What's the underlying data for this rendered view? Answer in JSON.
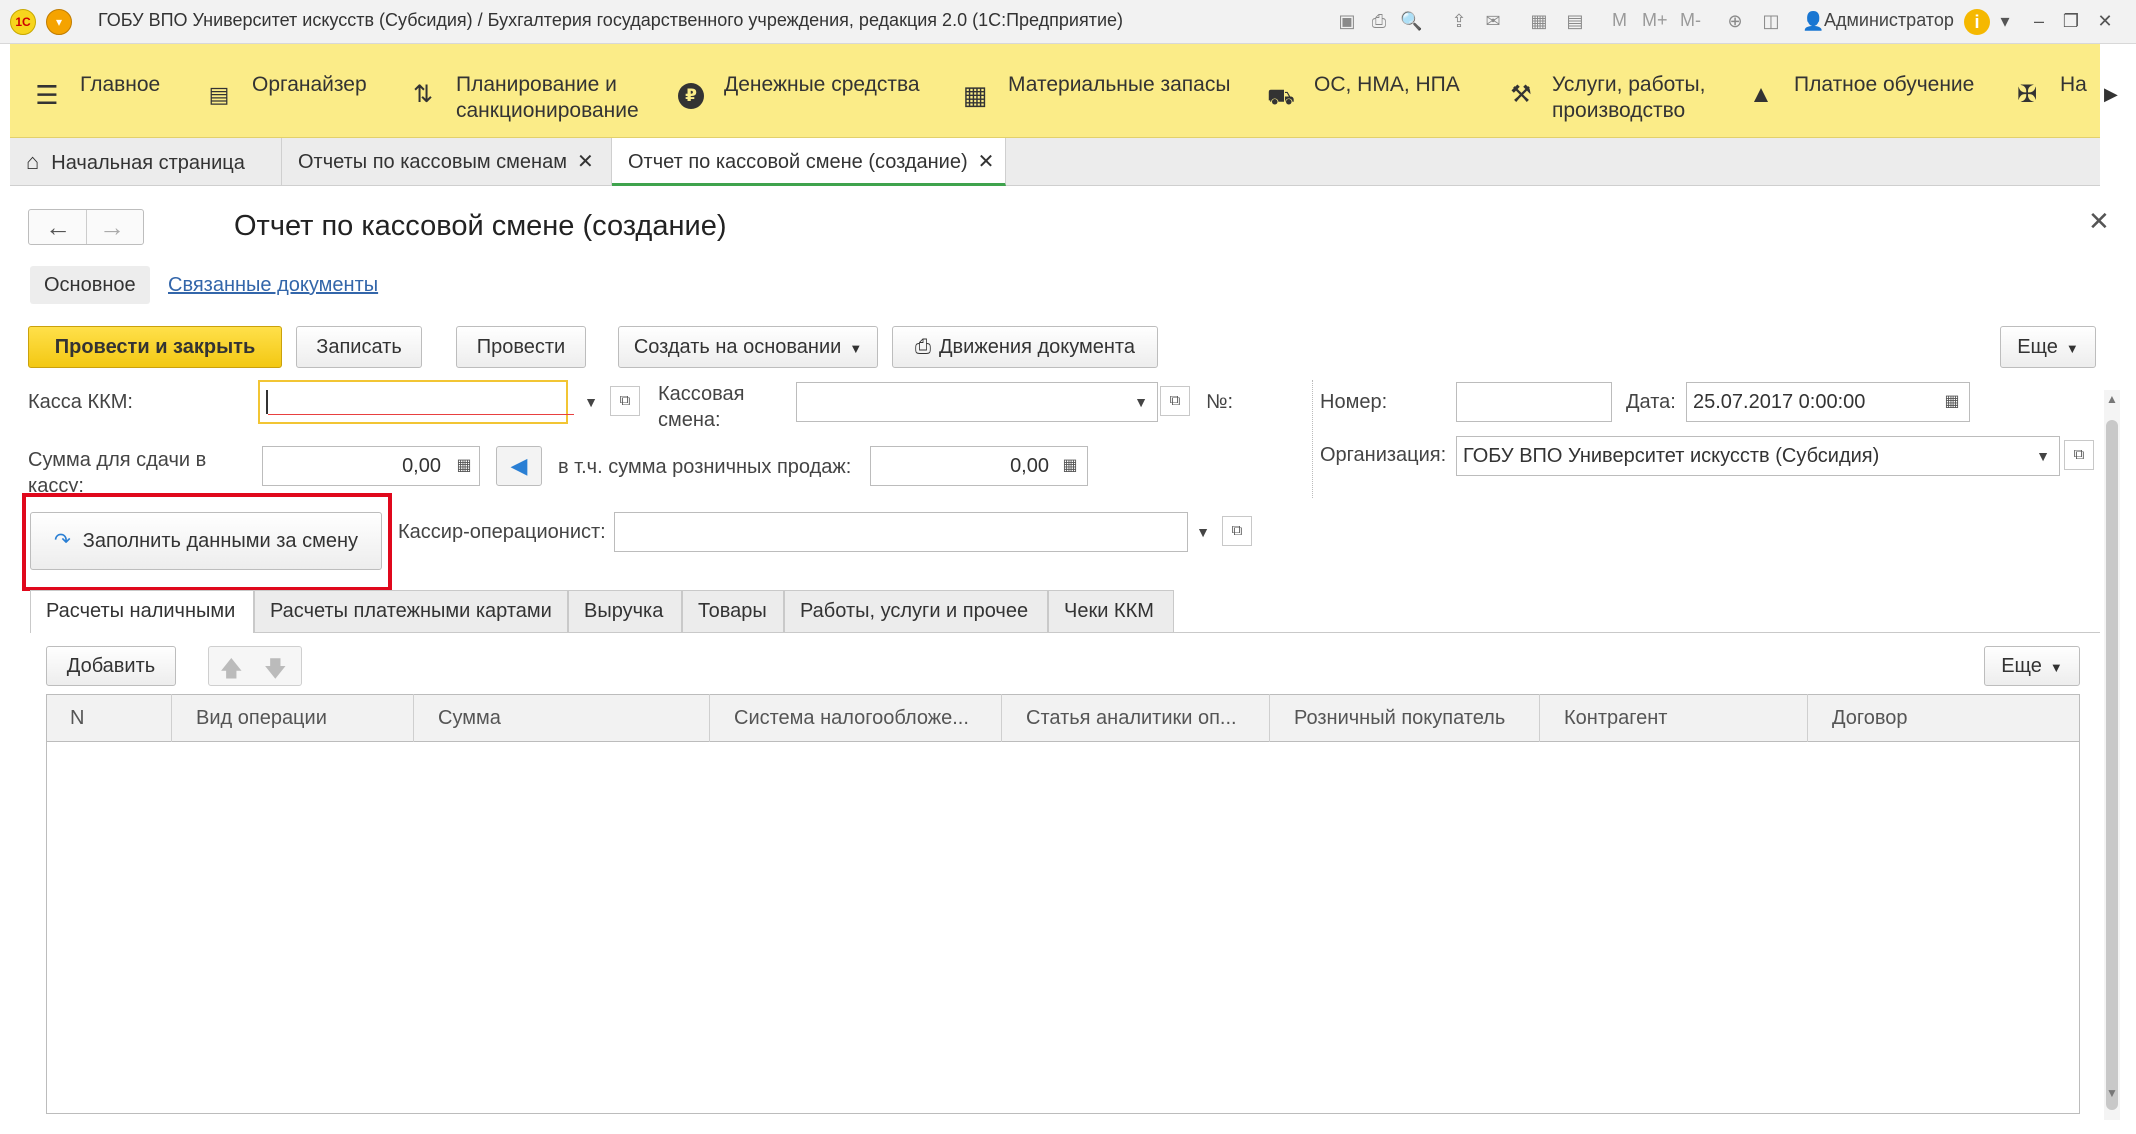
{
  "window": {
    "title": "ГОБУ ВПО Университет искусств (Субсидия) / Бухгалтерия государственного учреждения, редакция 2.0  (1С:Предприятие)",
    "logo_text": "1С",
    "user": "Администратор",
    "toolbar_m": [
      "M",
      "M+",
      "M-"
    ]
  },
  "sections": [
    {
      "icon": "menu-icon",
      "glyph": "☰",
      "label": "Главное"
    },
    {
      "icon": "clipboard-icon",
      "glyph": "📋",
      "label": "Органайзер"
    },
    {
      "icon": "planning-icon",
      "glyph": "⇅",
      "label": "Планирование и\nсанкционирование"
    },
    {
      "icon": "money-icon",
      "glyph": "₽",
      "label": "Денежные средства"
    },
    {
      "icon": "warehouse-icon",
      "glyph": "▦",
      "label": "Материальные запасы"
    },
    {
      "icon": "truck-icon",
      "glyph": "🚚",
      "label": "ОС, НМА, НПА"
    },
    {
      "icon": "tools-icon",
      "glyph": "⚒",
      "label": "Услуги, работы,\nпроизводство"
    },
    {
      "icon": "graduation-cap-icon",
      "glyph": "🎓",
      "label": "Платное обучение"
    },
    {
      "icon": "emblem-icon",
      "glyph": "✠",
      "label": "На"
    }
  ],
  "open_tabs": [
    {
      "label": "Начальная страница",
      "closable": false
    },
    {
      "label": "Отчеты по кассовым сменам",
      "closable": true
    },
    {
      "label": "Отчет по кассовой смене (создание)",
      "closable": true,
      "active": true
    }
  ],
  "form": {
    "title": "Отчет по кассовой смене (создание)",
    "nav": {
      "main": "Основное",
      "related": "Связанные документы"
    },
    "buttons": {
      "post_close": "Провести и закрыть",
      "save": "Записать",
      "post": "Провести",
      "create_based": "Создать на основании",
      "movements": "Движения документа",
      "more": "Еще"
    },
    "fields": {
      "kassa_label": "Касса ККМ:",
      "kassa_value": "",
      "shift_label_1": "Кассовая",
      "shift_label_2": "смена:",
      "shift_value": "",
      "no_label": "№:",
      "number_label": "Номер:",
      "number_value": "",
      "date_label": "Дата:",
      "date_value": "25.07.2017  0:00:00",
      "org_label": "Организация:",
      "org_value": "ГОБУ ВПО Университет искусств (Субсидия)",
      "sum_label_1": "Сумма для сдачи в",
      "sum_label_2": "кассу:",
      "sum_value": "0,00",
      "retail_label": "в т.ч. сумма розничных продаж:",
      "retail_value": "0,00",
      "fill_button": "Заполнить данными за  смену",
      "cashier_label": "Кассир-операционист:",
      "cashier_value": ""
    },
    "tabs": [
      "Расчеты наличными",
      "Расчеты платежными картами",
      "Выручка",
      "Товары",
      "Работы, услуги и прочее",
      "Чеки ККМ"
    ],
    "table_toolbar": {
      "add": "Добавить",
      "more": "Еще"
    },
    "columns": [
      "N",
      "Вид операции",
      "Сумма",
      "Система налогообложе...",
      "Статья аналитики оп...",
      "Розничный покупатель",
      "Контрагент",
      "Договор"
    ],
    "rows": []
  },
  "colors": {
    "accent_yellow": "#fbec88",
    "primary_button": "#f3c813",
    "highlight_red": "#e0081c",
    "active_tab_underline": "#3fa34d",
    "link": "#3366aa"
  }
}
